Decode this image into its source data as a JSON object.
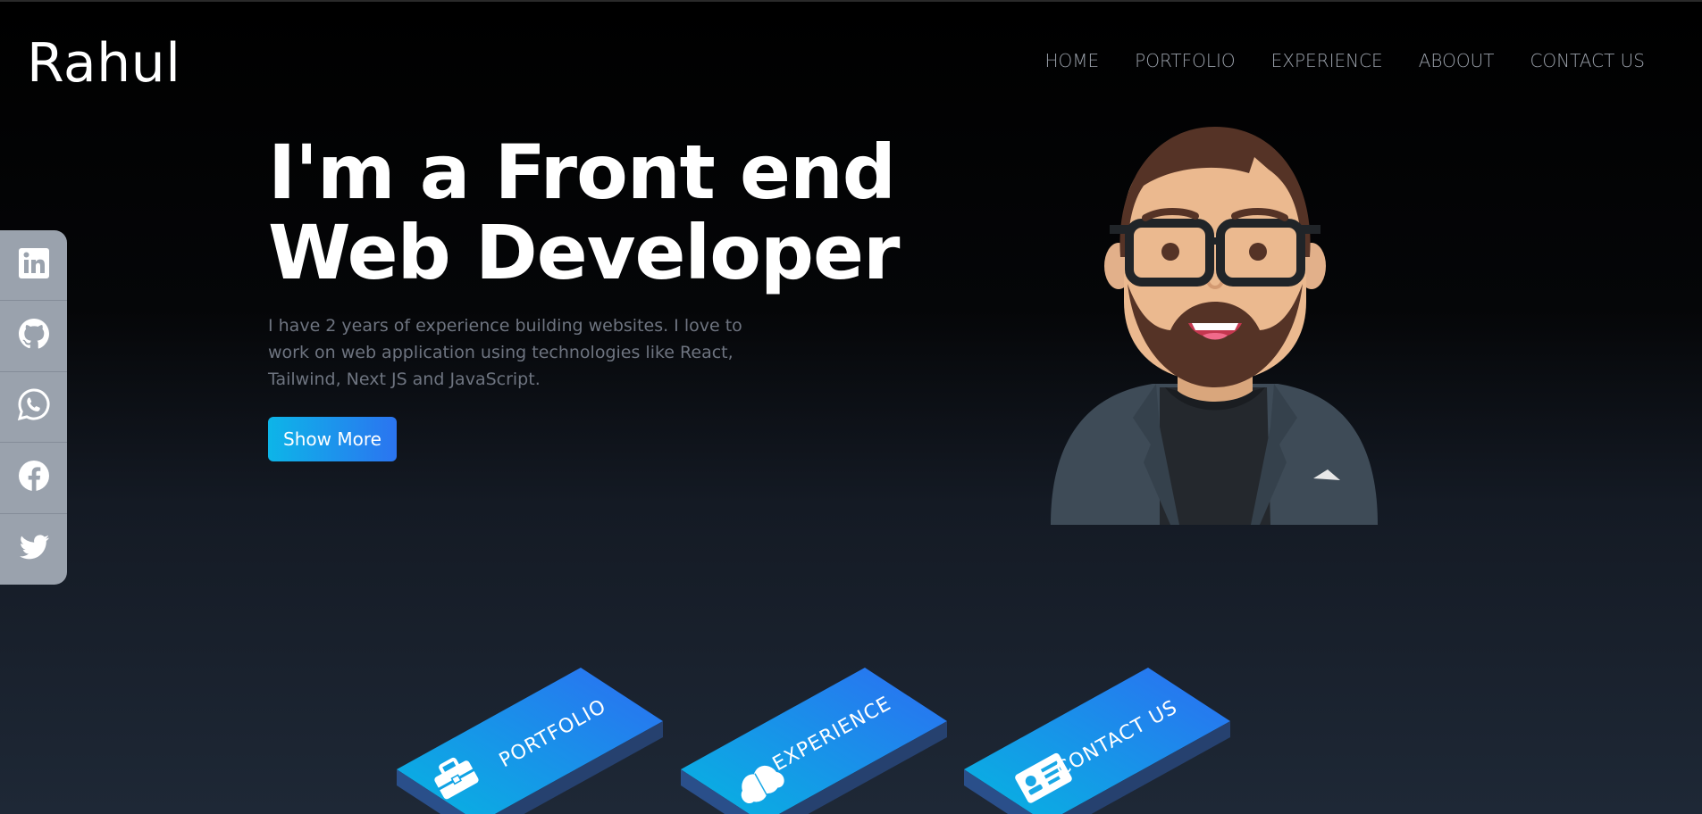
{
  "brand": {
    "name": "Rahul"
  },
  "nav": {
    "home": "HOME",
    "portfolio": "PORTFOLIO",
    "experience": "EXPERIENCE",
    "about": "ABOOUT",
    "contact": "CONTACT US"
  },
  "hero": {
    "title_line1": "I'm a Front end",
    "title_line2": "Web Developer",
    "description": "I have 2 years of experience building websites. I love to work on web application using technologies like React, Tailwind, Next JS and JavaScript.",
    "button_label": "Show More"
  },
  "social": {
    "items": [
      {
        "icon": "linkedin-icon"
      },
      {
        "icon": "github-icon"
      },
      {
        "icon": "whatsapp-icon"
      },
      {
        "icon": "facebook-icon"
      },
      {
        "icon": "twitter-icon"
      }
    ]
  },
  "cards": [
    {
      "label": "PORTFOLIO",
      "icon": "briefcase-icon"
    },
    {
      "label": "EXPERIENCE",
      "icon": "brain-icon"
    },
    {
      "label": "CONTACT US",
      "icon": "id-card-icon"
    }
  ],
  "colors": {
    "accent_start": "#0db5e8",
    "accent_end": "#2b74f0",
    "social_bg": "#9aa2ad",
    "nav_text": "#9aa0aa"
  }
}
